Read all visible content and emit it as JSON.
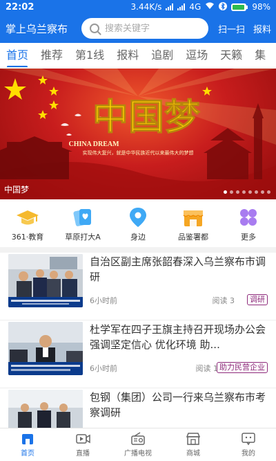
{
  "status": {
    "time": "22:02",
    "speed": "3.44K/s",
    "network": "4G",
    "battery": "98%"
  },
  "header": {
    "title": "掌上乌兰察布",
    "search_placeholder": "搜索关键字",
    "scan_label": "扫一扫",
    "report_label": "报料"
  },
  "tabs": [
    {
      "label": "首页"
    },
    {
      "label": "推荐"
    },
    {
      "label": "第1线"
    },
    {
      "label": "报料"
    },
    {
      "label": "追剧"
    },
    {
      "label": "逗场"
    },
    {
      "label": "天籁"
    },
    {
      "label": "集"
    }
  ],
  "banner": {
    "caption": "中国梦",
    "headline": "中国梦",
    "subhead": "CHINA DREAM",
    "tagline": "实现伟大复兴，就是中华民族近代以来最伟大的梦想",
    "slide_index": 1,
    "slide_count": 8
  },
  "quick_links": [
    {
      "label": "361·教育",
      "icon": "graduation-cap-icon",
      "color": "#f5b92e"
    },
    {
      "label": "草原打大A",
      "icon": "cards-heart-icon",
      "color": "#3fa9f5"
    },
    {
      "label": "身边",
      "icon": "location-pin-icon",
      "color": "#3fa9f5"
    },
    {
      "label": "品鉴署都",
      "icon": "shop-icon",
      "color": "#f5a623"
    },
    {
      "label": "更多",
      "icon": "more-grid-icon",
      "color": "#a87cf0"
    }
  ],
  "news": [
    {
      "title": "自治区副主席张韶春深入乌兰察布市调研",
      "time": "6小时前",
      "reads": "阅读 3",
      "tag": "调研"
    },
    {
      "title": "杜学军在四子王旗主持召开现场办公会强调坚定信心 优化环境 助...",
      "time": "6小时前",
      "reads": "阅读 1",
      "tag": "助力民营企业"
    },
    {
      "title": "包钢（集团）公司一行来乌兰察布市考察调研",
      "time": "",
      "reads": "",
      "tag": ""
    }
  ],
  "bottom_nav": [
    {
      "label": "首页",
      "icon": "home-icon"
    },
    {
      "label": "直播",
      "icon": "live-video-icon"
    },
    {
      "label": "广播电视",
      "icon": "radio-tv-icon"
    },
    {
      "label": "商城",
      "icon": "store-icon"
    },
    {
      "label": "我的",
      "icon": "profile-icon"
    }
  ],
  "colors": {
    "brand": "#1a73e8",
    "tag": "#8e2a7b"
  }
}
